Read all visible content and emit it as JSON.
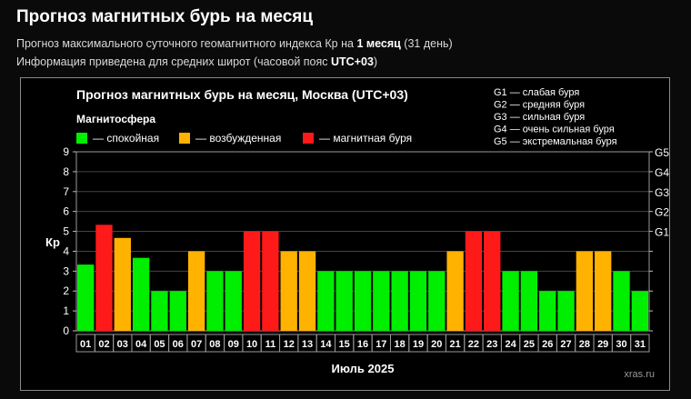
{
  "page": {
    "title": "Прогноз магнитных бурь на месяц",
    "line1_prefix": "Прогноз максимального суточного геомагнитного индекса Кр на ",
    "line1_bold": "1 месяц",
    "line1_suffix": " (31 день)",
    "line2_prefix": "Информация приведена для средних широт (часовой пояс ",
    "line2_bold": "UTC+03",
    "line2_suffix": ")"
  },
  "colors": {
    "calm": "#00ee00",
    "excited": "#ffb300",
    "storm": "#ff1a1a",
    "background": "#000000",
    "frame": "#8a8a8a",
    "grid": "#444444"
  },
  "chart_data": {
    "type": "bar",
    "title": "Прогноз магнитных бурь на месяц, Москва (UTC+03)",
    "legend_title": "Магнитосфера",
    "legend": [
      {
        "key": "calm",
        "label": "— спокойная"
      },
      {
        "key": "excited",
        "label": "— возбужденная"
      },
      {
        "key": "storm",
        "label": "— магнитная буря"
      }
    ],
    "g_legend": [
      "G1 — слабая буря",
      "G2 — средняя буря",
      "G3 — сильная буря",
      "G4 — очень сильная буря",
      "G5 — экстремальная буря"
    ],
    "ylabel": "Кр",
    "xlabel": "Июль 2025",
    "ylim": [
      0,
      9
    ],
    "yticks": [
      "0",
      "1",
      "2",
      "3",
      "4",
      "5",
      "6",
      "7",
      "8",
      "9"
    ],
    "right_axis": [
      {
        "label": "G1",
        "value": 5
      },
      {
        "label": "G2",
        "value": 6
      },
      {
        "label": "G3",
        "value": 7
      },
      {
        "label": "G4",
        "value": 8
      },
      {
        "label": "G5",
        "value": 9
      }
    ],
    "categories": [
      "01",
      "02",
      "03",
      "04",
      "05",
      "06",
      "07",
      "08",
      "09",
      "10",
      "11",
      "12",
      "13",
      "14",
      "15",
      "16",
      "17",
      "18",
      "19",
      "20",
      "21",
      "22",
      "23",
      "24",
      "25",
      "26",
      "27",
      "28",
      "29",
      "30",
      "31"
    ],
    "values": [
      3.33,
      5.33,
      4.67,
      3.67,
      2,
      2,
      4,
      3,
      3,
      5,
      5,
      4,
      4,
      3,
      3,
      3,
      3,
      3,
      3,
      3,
      4,
      5,
      5,
      3,
      3,
      2,
      2,
      4,
      4,
      3,
      2
    ],
    "levels": [
      "calm",
      "storm",
      "excited",
      "calm",
      "calm",
      "calm",
      "excited",
      "calm",
      "calm",
      "storm",
      "storm",
      "excited",
      "excited",
      "calm",
      "calm",
      "calm",
      "calm",
      "calm",
      "calm",
      "calm",
      "excited",
      "storm",
      "storm",
      "calm",
      "calm",
      "calm",
      "calm",
      "excited",
      "excited",
      "calm",
      "calm"
    ],
    "watermark": "xras.ru"
  }
}
